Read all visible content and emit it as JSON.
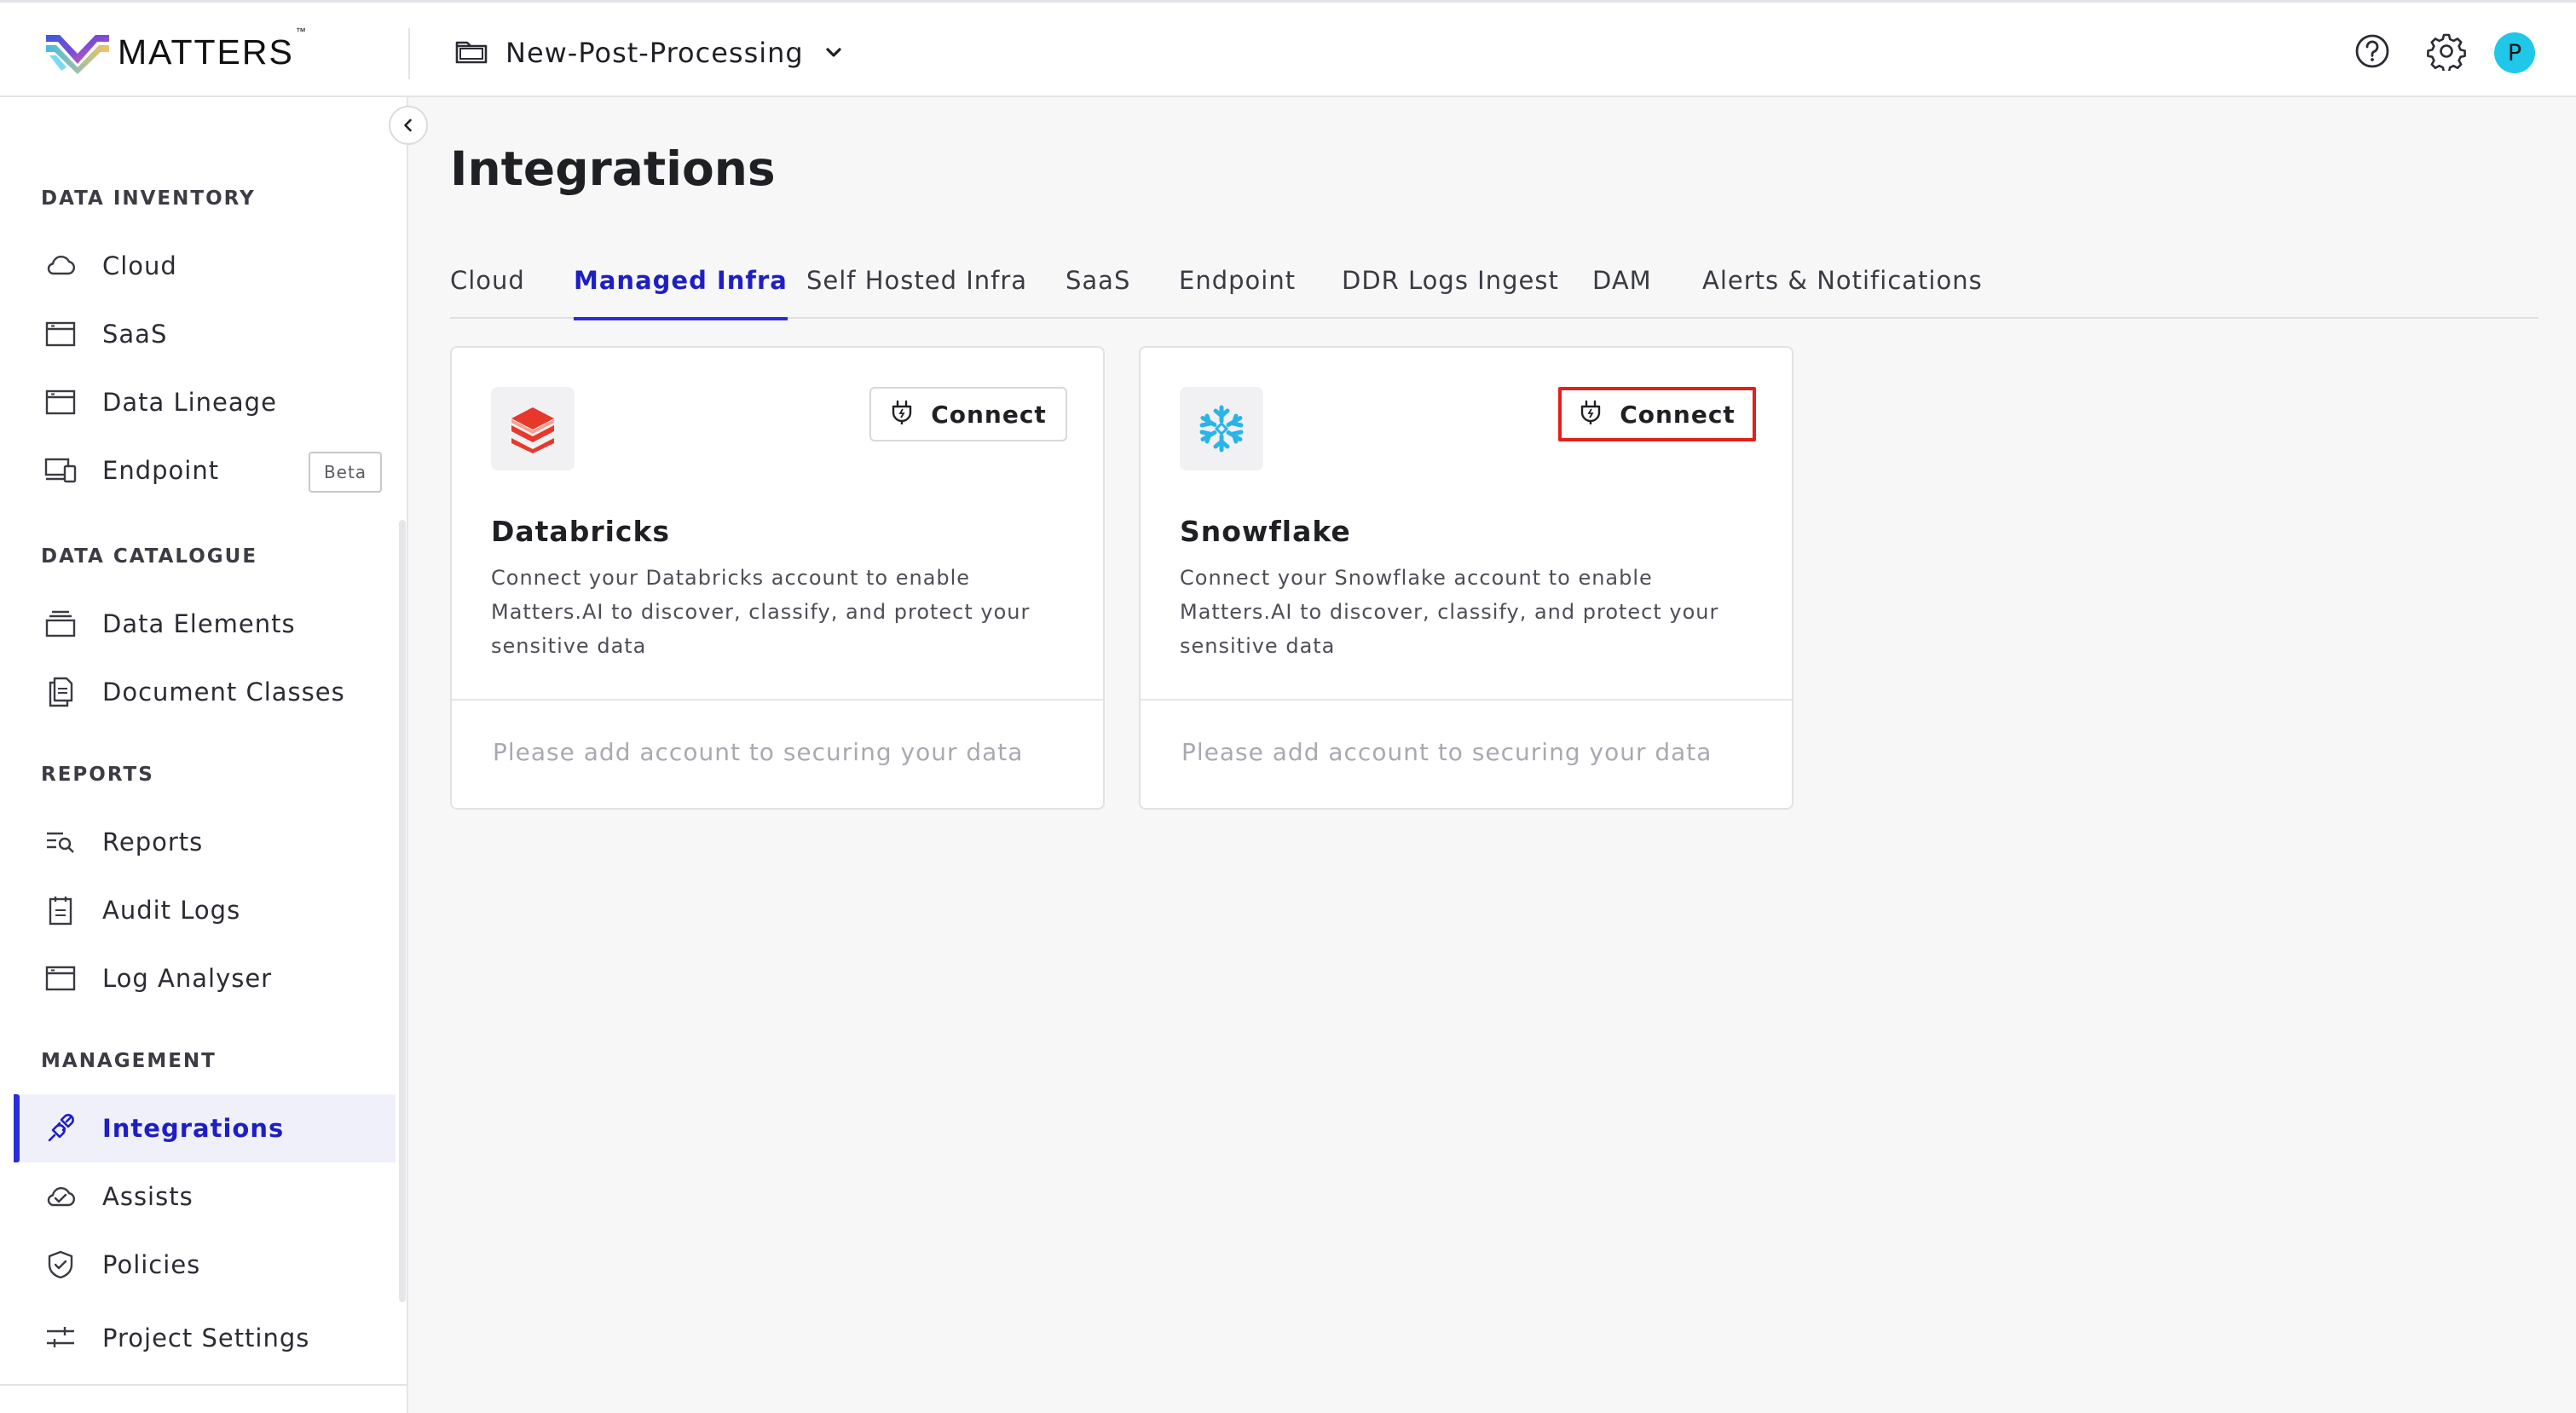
{
  "header": {
    "brand": "MATTERS",
    "brand_tm": "™",
    "project_name": "New-Post-Processing",
    "avatar_initial": "P",
    "avatar_color": "#20c7e8"
  },
  "sidebar": {
    "sections": [
      {
        "title": "DATA INVENTORY",
        "items": [
          {
            "label": "Cloud",
            "icon": "cloud-icon"
          },
          {
            "label": "SaaS",
            "icon": "window-icon"
          },
          {
            "label": "Data Lineage",
            "icon": "window-icon"
          },
          {
            "label": "Endpoint",
            "icon": "devices-icon",
            "badge": "Beta"
          }
        ]
      },
      {
        "title": "DATA CATALOGUE",
        "items": [
          {
            "label": "Data Elements",
            "icon": "stack-icon"
          },
          {
            "label": "Document Classes",
            "icon": "documents-icon"
          }
        ]
      },
      {
        "title": "REPORTS",
        "items": [
          {
            "label": "Reports",
            "icon": "report-search-icon"
          },
          {
            "label": "Audit Logs",
            "icon": "clipboard-icon"
          },
          {
            "label": "Log Analyser",
            "icon": "window-icon"
          }
        ]
      },
      {
        "title": "MANAGEMENT",
        "items": [
          {
            "label": "Integrations",
            "icon": "plug-icon",
            "active": true
          },
          {
            "label": "Assists",
            "icon": "cloud-check-icon"
          },
          {
            "label": "Policies",
            "icon": "shield-check-icon"
          }
        ]
      }
    ],
    "footer_item": {
      "label": "Project Settings",
      "icon": "sliders-icon"
    }
  },
  "main": {
    "title": "Integrations",
    "tabs": [
      {
        "label": "Cloud"
      },
      {
        "label": "Managed Infra",
        "active": true
      },
      {
        "label": "Self Hosted Infra"
      },
      {
        "label": "SaaS"
      },
      {
        "label": "Endpoint"
      },
      {
        "label": "DDR Logs Ingest"
      },
      {
        "label": "DAM"
      },
      {
        "label": "Alerts & Notifications"
      }
    ],
    "cards": [
      {
        "name": "Databricks",
        "logo": "databricks-logo",
        "connect_label": "Connect",
        "description": "Connect your Databricks account to enable Matters.AI to discover, classify, and protect your sensitive data",
        "footer": "Please add account to securing your data"
      },
      {
        "name": "Snowflake",
        "logo": "snowflake-logo",
        "connect_label": "Connect",
        "highlighted": true,
        "description": "Connect your Snowflake account to enable Matters.AI to discover, classify, and protect your sensitive data",
        "footer": "Please add account to securing your data"
      }
    ]
  },
  "colors": {
    "accent": "#1d1fc4",
    "active_bar": "#2a2ddc",
    "highlight_border": "#e3201b",
    "databricks_red": "#e8382c",
    "snowflake_blue": "#29b5e8"
  }
}
